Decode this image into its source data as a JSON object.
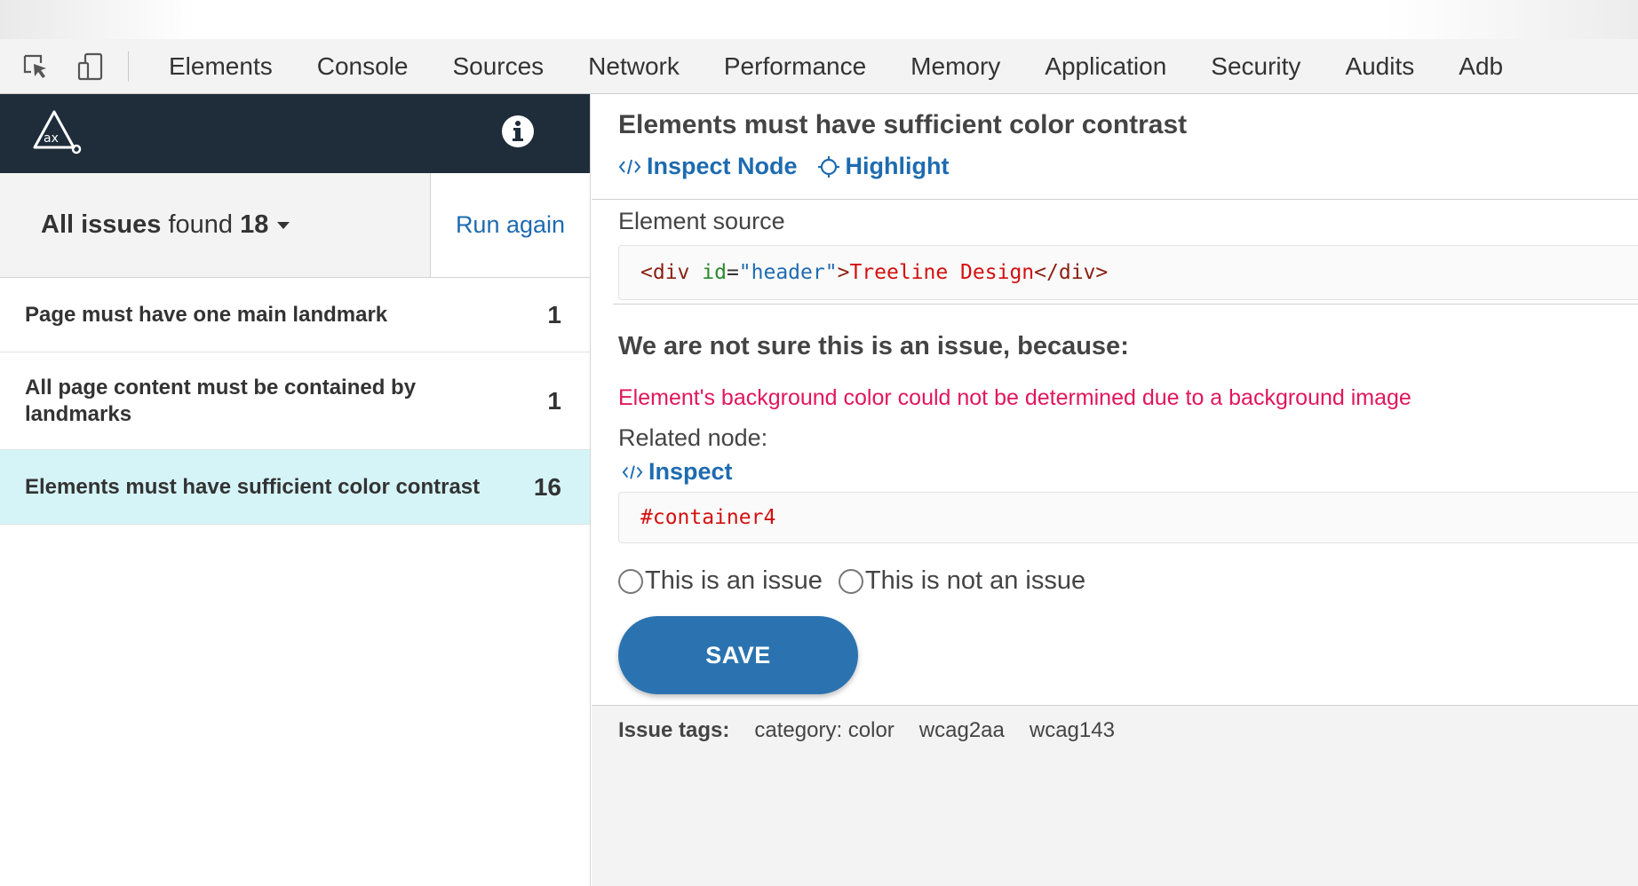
{
  "devtools": {
    "tabs": [
      "Elements",
      "Console",
      "Sources",
      "Network",
      "Performance",
      "Memory",
      "Application",
      "Security",
      "Audits",
      "Adb"
    ],
    "icons": [
      "inspect-element-icon",
      "device-toolbar-icon"
    ]
  },
  "sidebar": {
    "logo": "ax-logo",
    "info_icon": "info-icon",
    "summary": {
      "prefix": "All issues",
      "middle": " found ",
      "count": "18"
    },
    "run_again": "Run again",
    "issues": [
      {
        "label": "Page must have one main landmark",
        "count": "1"
      },
      {
        "label": "All page content must be contained by landmarks",
        "count": "1"
      },
      {
        "label": "Elements must have sufficient color contrast",
        "count": "16",
        "selected": true
      }
    ]
  },
  "detail": {
    "title": "Elements must have sufficient color contrast",
    "inspect_node": "Inspect Node",
    "highlight": "Highlight",
    "element_source_label": "Element source",
    "element_source": {
      "open": "<div",
      "attr": " id",
      "eq": "=",
      "value": "\"header\"",
      "close_open": ">",
      "text": "Treeline Design",
      "end": "</div>"
    },
    "uncertain_heading": "We are not sure this is an issue, because:",
    "reason": "Element's background color could not be determined due to a background image",
    "related_label": "Related node:",
    "inspect": "Inspect",
    "related_selector": "#container4",
    "radio_issue": "This is an issue",
    "radio_not_issue": "This is not an issue",
    "save": "SAVE",
    "tags_label": "Issue tags:",
    "tags": [
      "category: color",
      "wcag2aa",
      "wcag143"
    ]
  },
  "colors": {
    "header_bg": "#1f2d3a",
    "link": "#1e6bb0",
    "selected_row": "#d5f4f8",
    "reason_text": "#e0175a",
    "save_button": "#2b73b0"
  }
}
